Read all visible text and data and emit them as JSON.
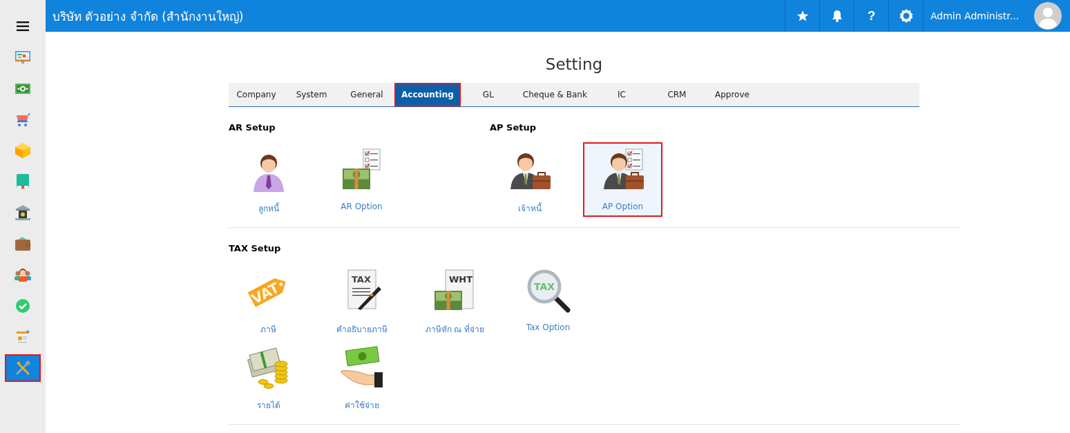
{
  "header": {
    "company": "บริษัท ตัวอย่าง จำกัด (สำนักงานใหญ่)",
    "actions": [
      {
        "kind": "star"
      },
      {
        "kind": "bell"
      },
      {
        "kind": "help",
        "label": "?"
      },
      {
        "kind": "settings"
      }
    ],
    "user": "Admin Administr..."
  },
  "sidebar": {
    "items": [
      {
        "kind": "menu",
        "selected": false,
        "highlighted": false
      },
      {
        "kind": "monitor",
        "selected": false,
        "highlighted": false
      },
      {
        "kind": "money",
        "selected": false,
        "highlighted": false
      },
      {
        "kind": "cart",
        "selected": false,
        "highlighted": false
      },
      {
        "kind": "box",
        "selected": false,
        "highlighted": false
      },
      {
        "kind": "book",
        "selected": false,
        "highlighted": false
      },
      {
        "kind": "bank",
        "selected": false,
        "highlighted": false
      },
      {
        "kind": "wallet",
        "selected": false,
        "highlighted": false
      },
      {
        "kind": "people",
        "selected": false,
        "highlighted": false
      },
      {
        "kind": "check",
        "selected": false,
        "highlighted": false
      },
      {
        "kind": "invoice",
        "selected": false,
        "highlighted": false
      },
      {
        "kind": "tools",
        "selected": true,
        "highlighted": true
      }
    ]
  },
  "page_title": "Setting",
  "tabs": [
    {
      "label": "Company",
      "selected": false,
      "highlighted": false
    },
    {
      "label": "System",
      "selected": false,
      "highlighted": false
    },
    {
      "label": "General",
      "selected": false,
      "highlighted": false
    },
    {
      "label": "Accounting",
      "selected": true,
      "highlighted": true
    },
    {
      "label": "GL",
      "selected": false,
      "highlighted": false
    },
    {
      "label": "Cheque & Bank",
      "selected": false,
      "highlighted": false
    },
    {
      "label": "IC",
      "selected": false,
      "highlighted": false
    },
    {
      "label": "CRM",
      "selected": false,
      "highlighted": false
    },
    {
      "label": "Approve",
      "selected": false,
      "highlighted": false
    }
  ],
  "panels": [
    {
      "groups": [
        {
          "title": "AR Setup",
          "tiles": [
            {
              "kind": "customer",
              "label": "ลูกหนี้",
              "highlighted": false
            },
            {
              "kind": "money-checklist",
              "label": "AR Option",
              "highlighted": false
            }
          ]
        },
        {
          "title": "AP Setup",
          "tiles": [
            {
              "kind": "vendor",
              "label": "เจ้าหนี้",
              "highlighted": false
            },
            {
              "kind": "vendor-checklist",
              "label": "AP Option",
              "highlighted": true
            }
          ]
        }
      ]
    },
    {
      "groups": [
        {
          "title": "TAX Setup",
          "tiles": [
            {
              "kind": "tag",
              "label": "ภาษี",
              "icon_text": "VAT",
              "highlighted": false
            },
            {
              "kind": "document-pen",
              "label": "คำอธิบายภาษี",
              "icon_text": "TAX",
              "highlighted": false
            },
            {
              "kind": "document-money",
              "label": "ภาษีหัก ณ ที่จ่าย",
              "icon_text": "WHT",
              "highlighted": false
            },
            {
              "kind": "magnifier",
              "label": "Tax Option",
              "icon_text": "TAX",
              "highlighted": false
            },
            {
              "kind": "cash-coins",
              "label": "รายได้",
              "highlighted": false
            },
            {
              "kind": "hand-money",
              "label": "ค่าใช้จ่าย",
              "highlighted": false
            }
          ]
        }
      ]
    }
  ]
}
